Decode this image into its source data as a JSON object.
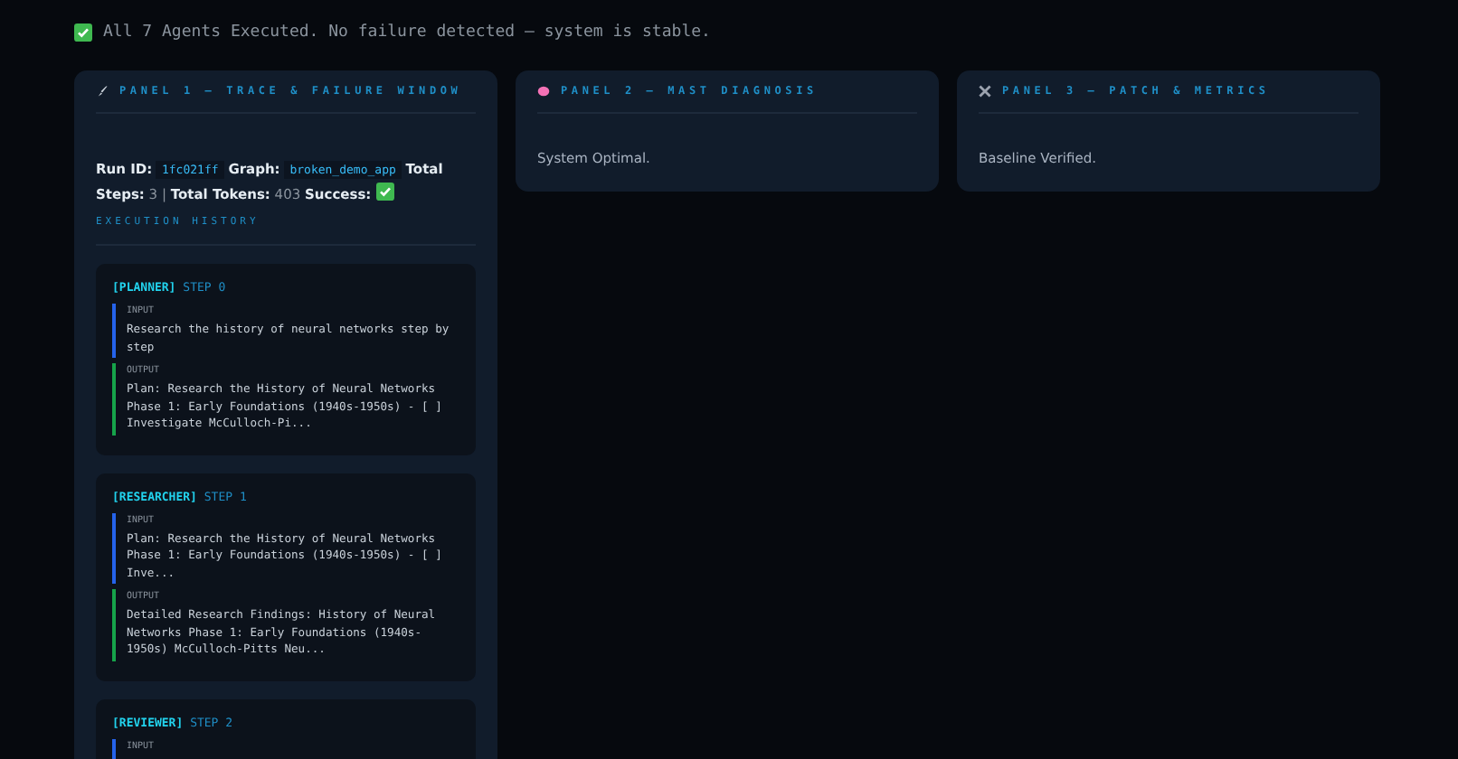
{
  "status_message": "All 7 Agents Executed. No failure detected — system is stable.",
  "panels": [
    {
      "kind": "trace",
      "title": "PANEL 1 — TRACE & FAILURE WINDOW",
      "run": {
        "run_id_label": "Run ID:",
        "run_id": "1fc021ff",
        "graph_label": "Graph:",
        "graph": "broken_demo_app",
        "steps_label": "Total Steps:",
        "steps": "3 |",
        "tokens_label": "Total Tokens:",
        "tokens": "403",
        "success_label": "Success:",
        "success": true
      },
      "history_title": "EXECUTION HISTORY",
      "steps": [
        {
          "agent": "[PLANNER]",
          "step": "STEP 0",
          "sections": [
            {
              "kind": "input",
              "label": "INPUT",
              "text": "Research the history of neural networks step by step"
            },
            {
              "kind": "output",
              "label": "OUTPUT",
              "text": "Plan: Research the History of Neural Networks Phase 1: Early Foundations (1940s-1950s) - [ ] Investigate McCulloch-Pi..."
            }
          ]
        },
        {
          "agent": "[RESEARCHER]",
          "step": "STEP 1",
          "sections": [
            {
              "kind": "input",
              "label": "INPUT",
              "text": "Plan: Research the History of Neural Networks Phase 1: Early Foundations (1940s-1950s) - [ ] Inve..."
            },
            {
              "kind": "output",
              "label": "OUTPUT",
              "text": "Detailed Research Findings: History of Neural Networks Phase 1: Early Foundations (1940s-1950s) McCulloch-Pitts Neu..."
            }
          ]
        },
        {
          "agent": "[REVIEWER]",
          "step": "STEP 2",
          "sections": [
            {
              "kind": "input",
              "label": "INPUT"
            }
          ]
        }
      ]
    },
    {
      "kind": "diagnosis",
      "title": "PANEL 2 — MAST DIAGNOSIS",
      "text": "System Optimal."
    },
    {
      "kind": "patch",
      "title": "PANEL 3 — PATCH & METRICS",
      "text": "Baseline Verified."
    }
  ]
}
